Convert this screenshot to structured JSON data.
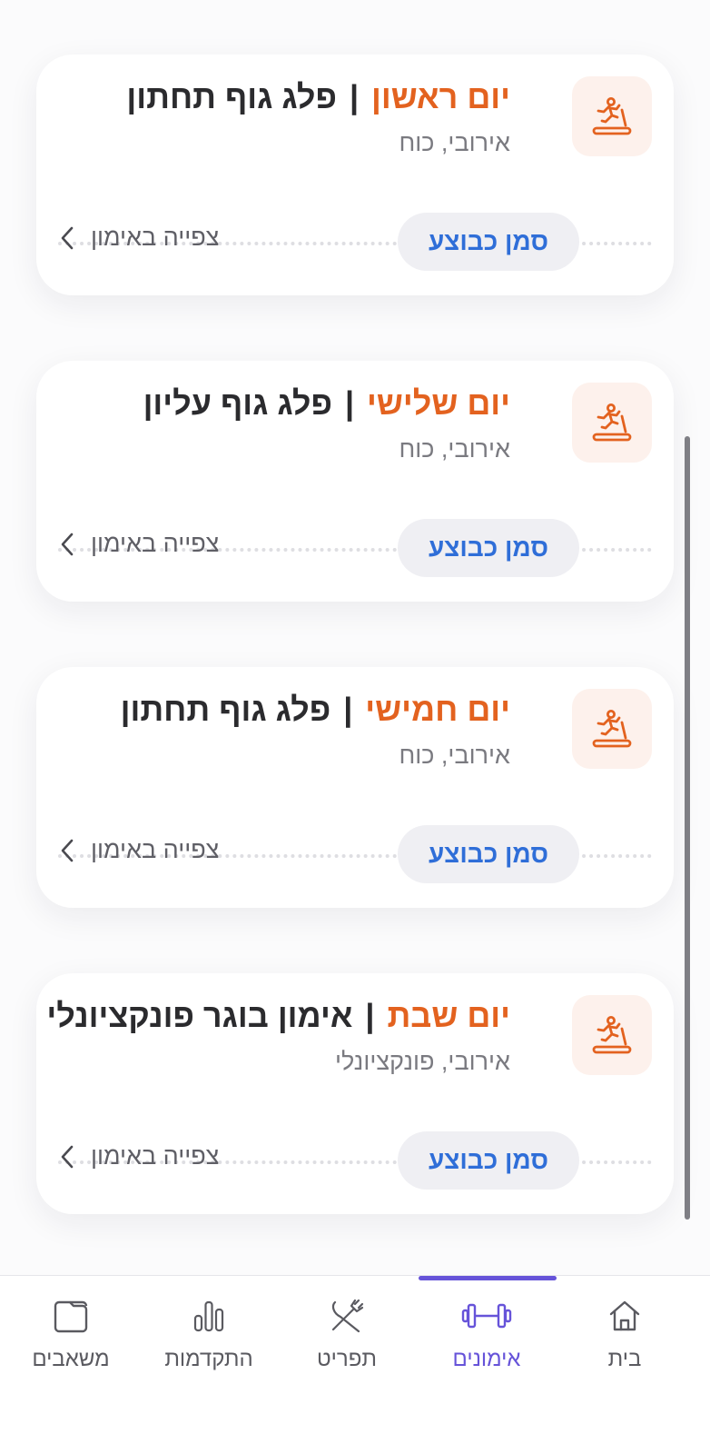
{
  "workouts": [
    {
      "day": "יום ראשון",
      "title": "פלג גוף תחתון",
      "tags": "אירובי, כוח",
      "mark_label": "סמן כבוצע",
      "view_label": "צפייה באימון"
    },
    {
      "day": "יום שלישי",
      "title": "פלג גוף עליון",
      "tags": "אירובי, כוח",
      "mark_label": "סמן כבוצע",
      "view_label": "צפייה באימון"
    },
    {
      "day": "יום חמישי",
      "title": "פלג גוף תחתון",
      "tags": "אירובי, כוח",
      "mark_label": "סמן כבוצע",
      "view_label": "צפייה באימון"
    },
    {
      "day": "יום שבת",
      "title": "אימון בוגר פונקציונלי",
      "tags": "אירובי, פונקציונלי",
      "mark_label": "סמן כבוצע",
      "view_label": "צפייה באימון"
    }
  ],
  "separator": "|",
  "card_icon": "treadmill-runner-icon",
  "tabs": [
    {
      "label": "בית",
      "icon": "home-icon",
      "active": false
    },
    {
      "label": "אימונים",
      "icon": "dumbbell-icon",
      "active": true
    },
    {
      "label": "תפריט",
      "icon": "fork-knife-icon",
      "active": false
    },
    {
      "label": "התקדמות",
      "icon": "bar-chart-icon",
      "active": false
    },
    {
      "label": "משאבים",
      "icon": "folder-icon",
      "active": false
    }
  ],
  "colors": {
    "accent_orange": "#e3621f",
    "link_blue": "#2f6ed8",
    "active_tab": "#6653d9",
    "icon_tile_bg": "#fdf1ec"
  }
}
